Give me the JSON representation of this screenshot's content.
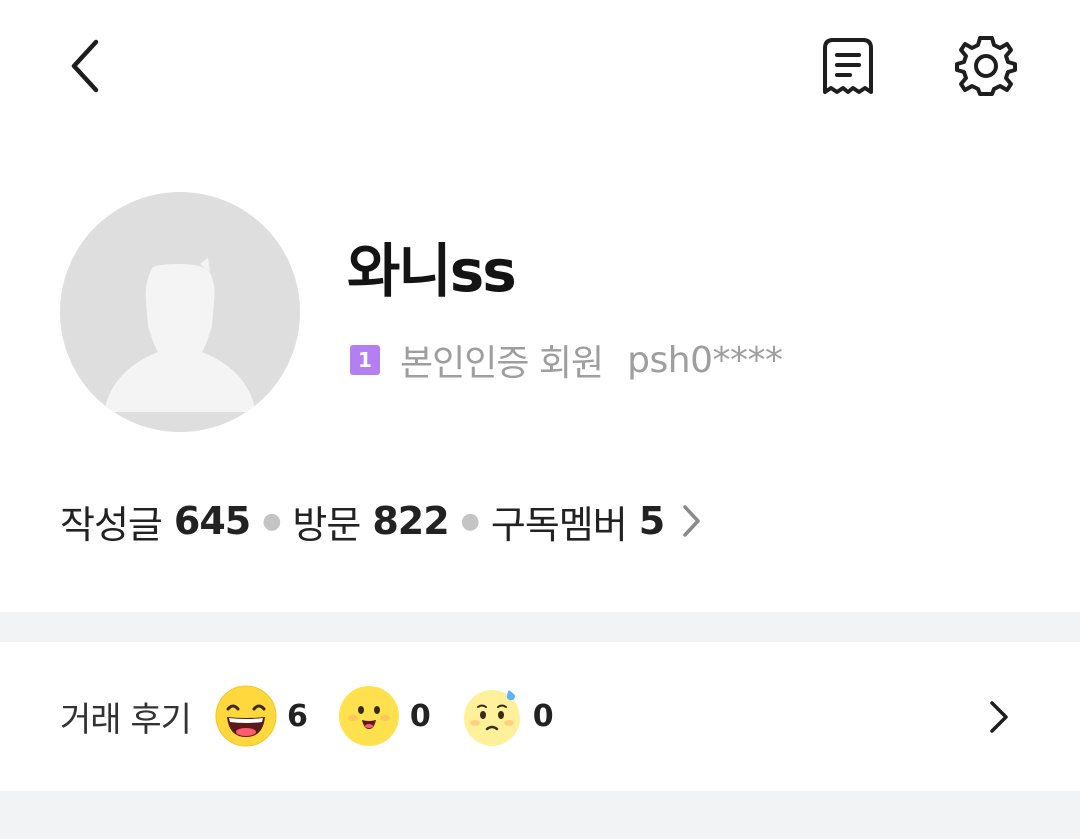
{
  "profile": {
    "nickname": "와니ss",
    "badge_number": "1",
    "badge_label": "본인인증 회원",
    "user_id": "psh0****"
  },
  "stats": {
    "posts_label": "작성글",
    "posts_value": "645",
    "visits_label": "방문",
    "visits_value": "822",
    "subscribers_label": "구독멤버",
    "subscribers_value": "5"
  },
  "reviews": {
    "label": "거래 후기",
    "items": [
      {
        "icon": "laughing-face-icon",
        "count": "6"
      },
      {
        "icon": "smiling-face-icon",
        "count": "0"
      },
      {
        "icon": "sweating-face-icon",
        "count": "0"
      }
    ]
  },
  "colors": {
    "badge": "#b47ff0",
    "divider": "#f2f3f5",
    "secondary_text": "#9e9e9e"
  }
}
